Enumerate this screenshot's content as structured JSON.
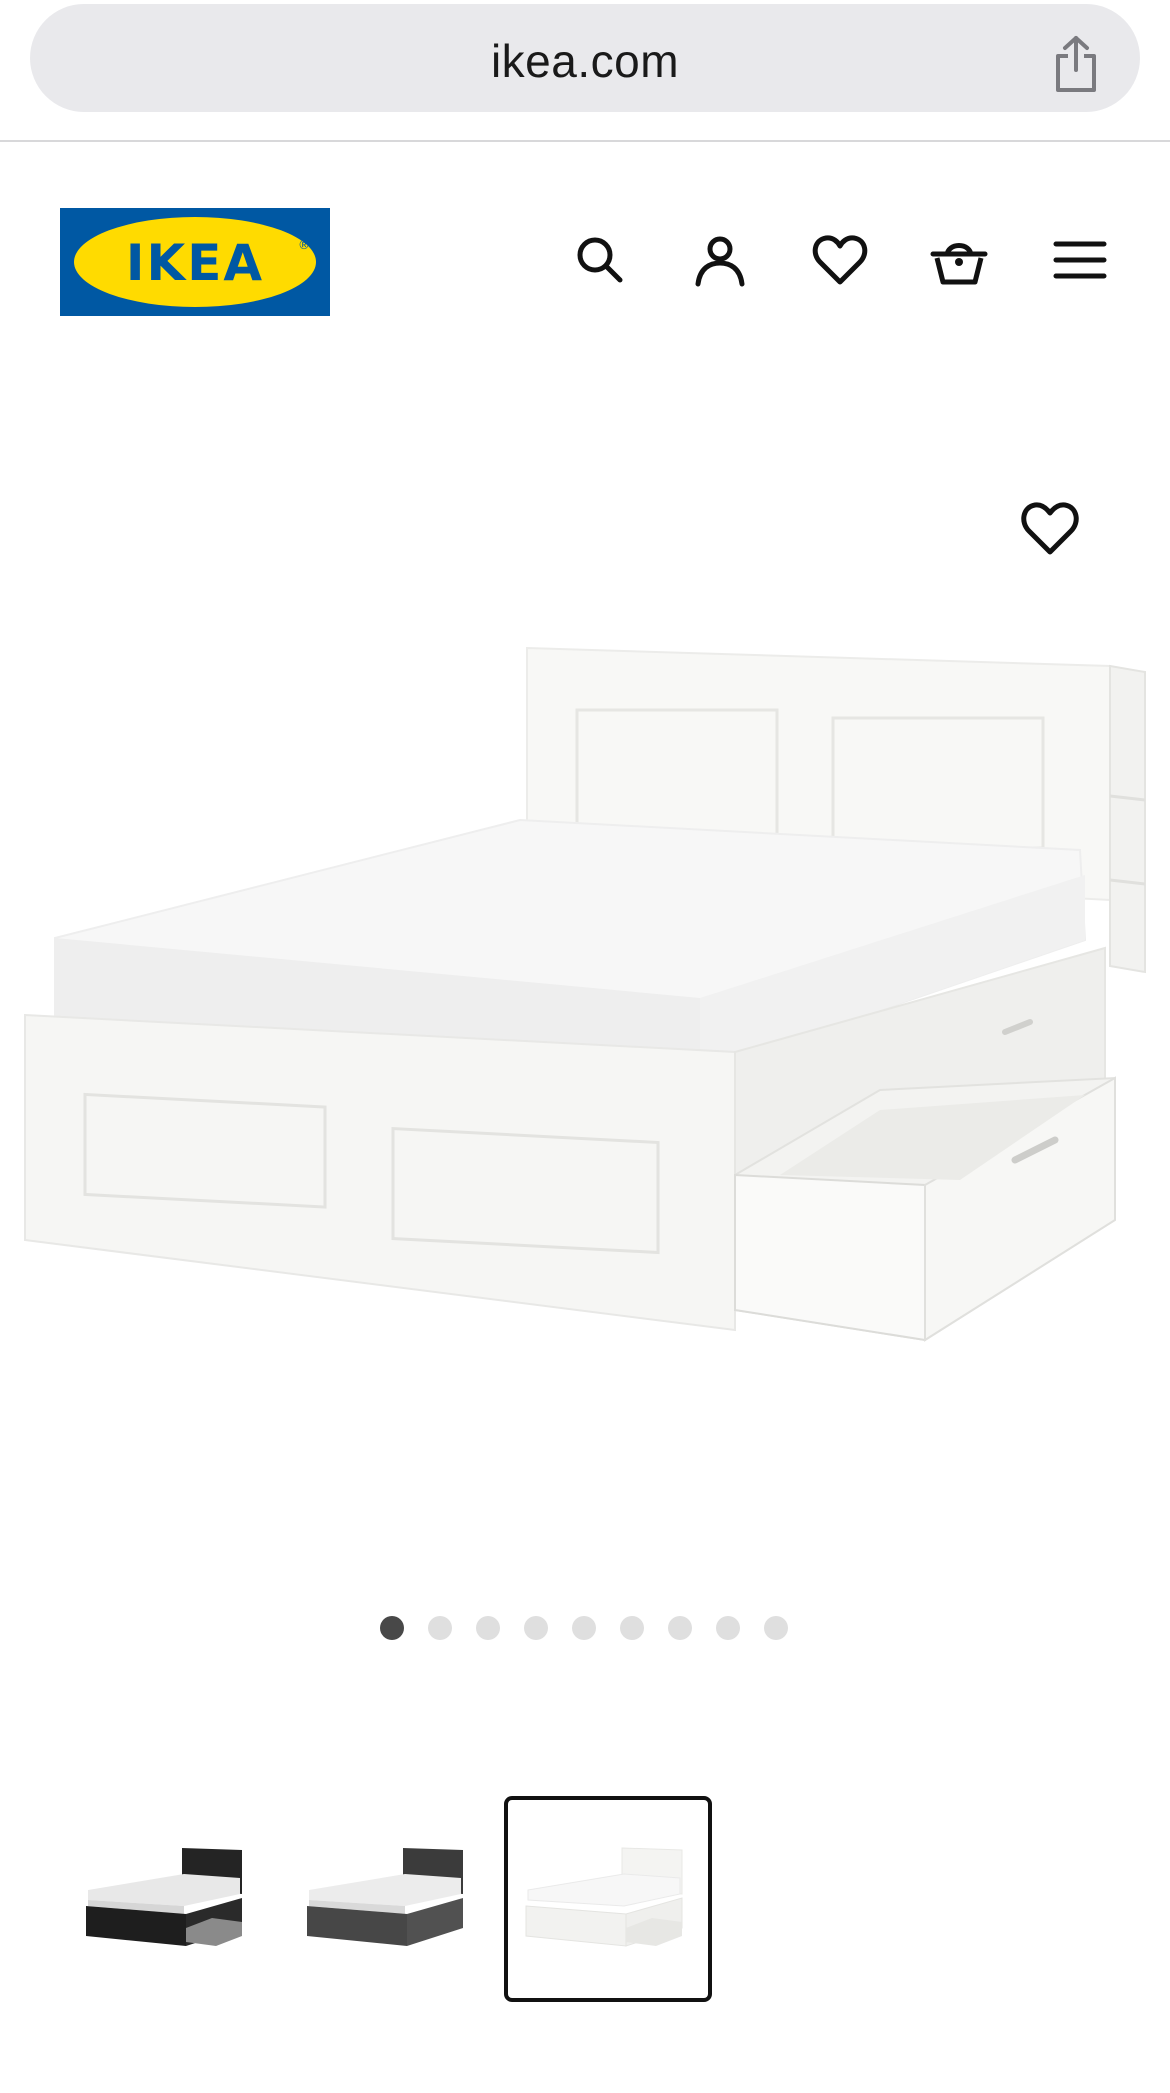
{
  "browser": {
    "url": "ikea.com",
    "share_icon": "share-icon"
  },
  "header": {
    "logo_text": "IKEA",
    "logo_colors": {
      "blue": "#0058a3",
      "yellow": "#ffdb00"
    },
    "icons": [
      "search-icon",
      "user-icon",
      "heart-icon",
      "basket-icon",
      "menu-icon"
    ]
  },
  "product": {
    "wishlist_icon": "heart-outline-icon",
    "gallery": {
      "total_images": 9,
      "active_index": 0
    },
    "color_options": [
      {
        "name_icon": "bed-black-brown-thumbnail",
        "selected": false
      },
      {
        "name_icon": "bed-dark-gray-thumbnail",
        "selected": false
      },
      {
        "name_icon": "bed-white-thumbnail",
        "selected": true
      }
    ]
  }
}
